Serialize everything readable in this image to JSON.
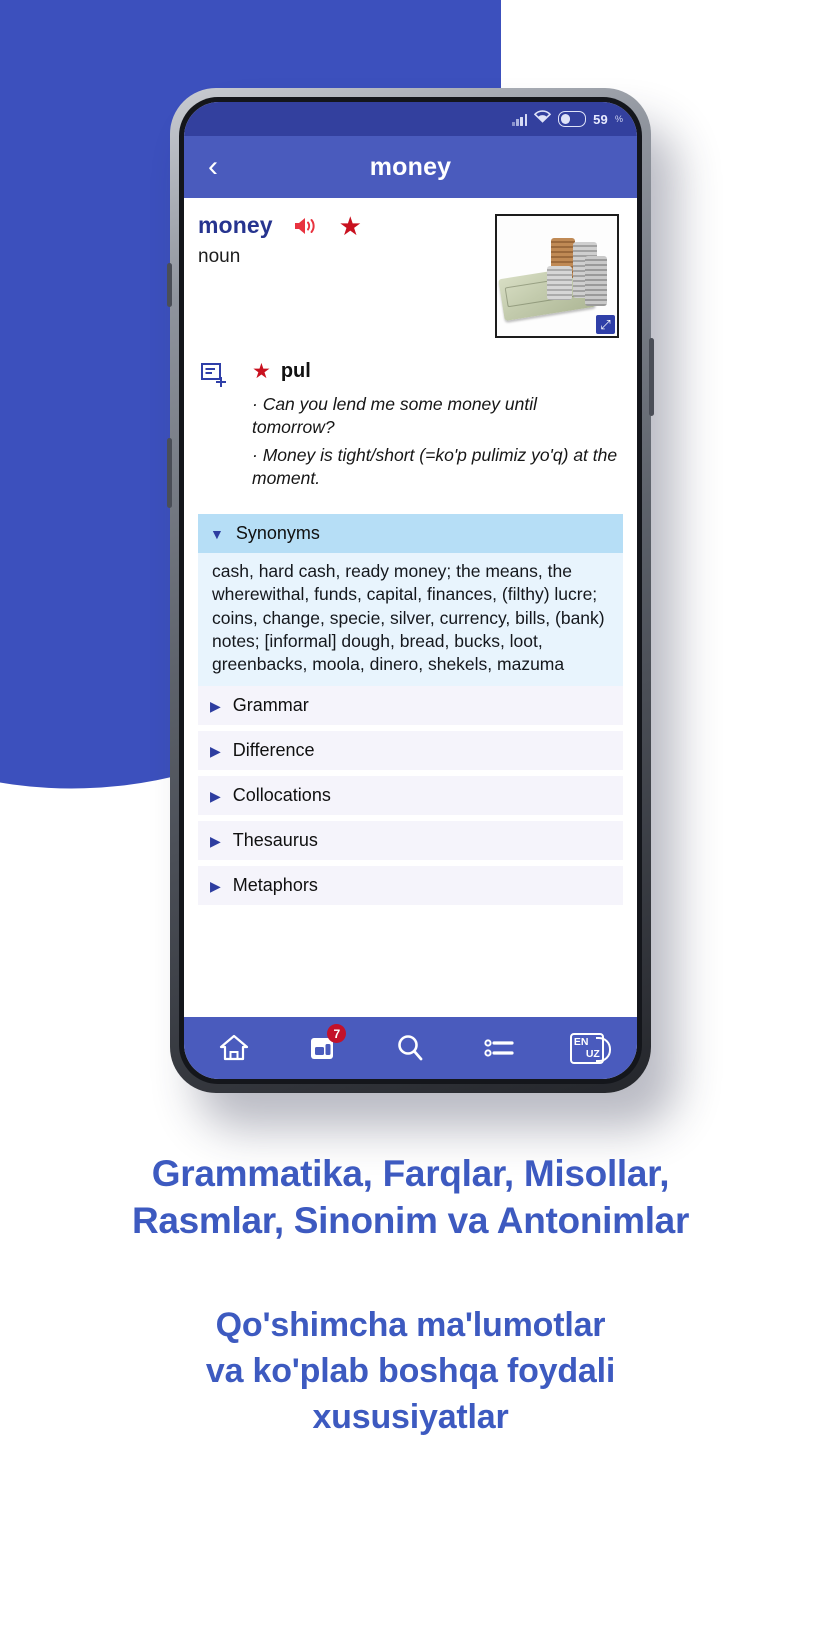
{
  "status_bar": {
    "signal_icon": "signal-bars-icon",
    "wifi_icon": "wifi-icon",
    "battery_icon": "battery-icon",
    "battery_percent": "59",
    "percent_symbol": "%"
  },
  "app_bar": {
    "back_icon": "‹",
    "title": "money"
  },
  "entry": {
    "headword": "money",
    "speaker_icon": "speaker-icon",
    "favorite_icon": "star-icon",
    "part_of_speech": "noun",
    "image_alt": "money-photo",
    "expand_icon": "⤢"
  },
  "sense": {
    "add_note_icon": "add-note-icon",
    "star_icon": "star-icon",
    "translation": "pul",
    "examples": [
      "· Can you lend me some money until tomorrow?",
      "· Money is tight/short (=ko'p pulimiz yo'q) at the moment."
    ]
  },
  "sections": [
    {
      "label": "Synonyms",
      "expanded": true,
      "arrow": "▼",
      "body": "cash, hard cash, ready money; the means, the wherewithal, funds, capital, finances, (filthy) lucre; coins, change, specie, silver, currency, bills, (bank) notes; [informal] dough, bread, bucks, loot, greenbacks, moola, dinero, shekels, mazuma"
    },
    {
      "label": "Grammar",
      "expanded": false,
      "arrow": "▶",
      "body": ""
    },
    {
      "label": "Difference",
      "expanded": false,
      "arrow": "▶",
      "body": ""
    },
    {
      "label": "Collocations",
      "expanded": false,
      "arrow": "▶",
      "body": ""
    },
    {
      "label": "Thesaurus",
      "expanded": false,
      "arrow": "▶",
      "body": ""
    },
    {
      "label": "Metaphors",
      "expanded": false,
      "arrow": "▶",
      "body": ""
    }
  ],
  "bottom_nav": [
    {
      "name": "home-icon",
      "badge": ""
    },
    {
      "name": "flashcards-icon",
      "badge": "7"
    },
    {
      "name": "search-icon",
      "badge": ""
    },
    {
      "name": "list-icon",
      "badge": ""
    },
    {
      "name": "language-toggle-icon",
      "badge": "",
      "from": "EN",
      "to": "UZ"
    }
  ],
  "marketing": {
    "headline_line1": "Grammatika, Farqlar, Misollar,",
    "headline_line2": "Rasmlar, Sinonim va Antonimlar",
    "sub_line1": "Qo'shimcha ma'lumotlar",
    "sub_line2": "va ko'plab boshqa foydali",
    "sub_line3": "xususiyatlar"
  },
  "colors": {
    "brand_blue": "#3c50bd",
    "app_bar_blue": "#4a5bbd",
    "status_blue": "#33409e",
    "accent_red": "#c9111f",
    "open_section": "#b6def6",
    "closed_section": "#f5f4fb",
    "text_blue": "#3d5ac0"
  }
}
